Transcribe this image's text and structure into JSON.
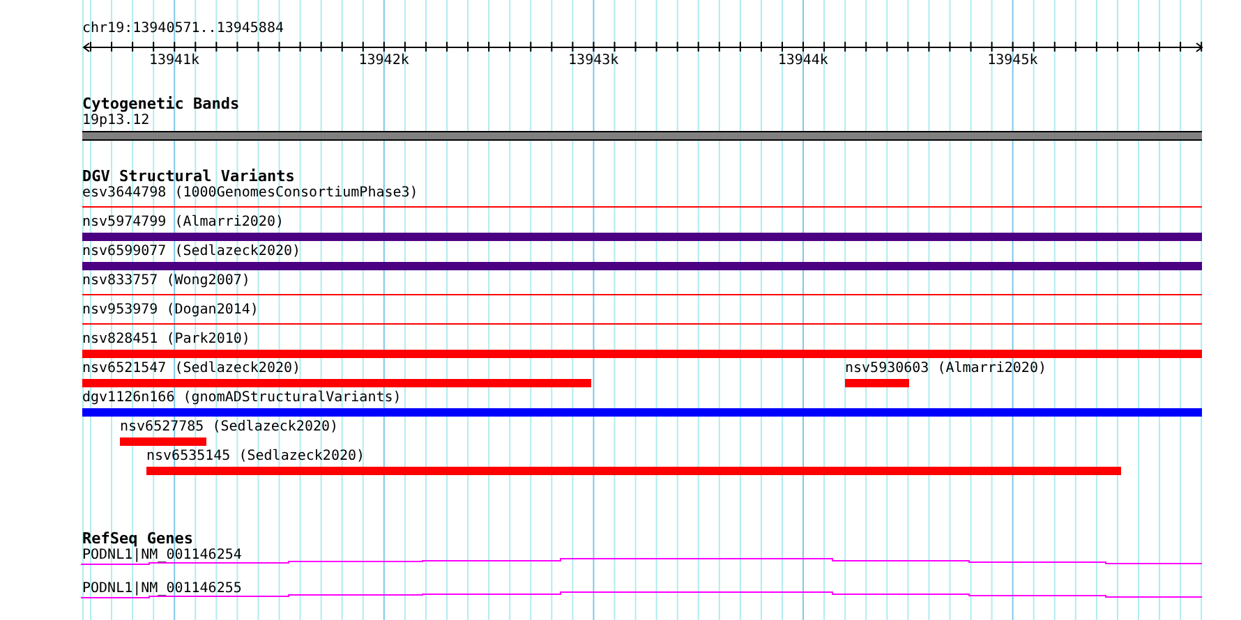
{
  "ruler": {
    "location": "chr19:13940571..13945884",
    "ticks": [
      "13941k",
      "13942k",
      "13943k",
      "13944k",
      "13945k"
    ]
  },
  "cytoband_track": {
    "title": "Cytogenetic Bands",
    "band": "19p13.12"
  },
  "variant_track": {
    "title": "DGV Structural Variants",
    "features": [
      {
        "label": "esv3644798 (1000GenomesConsortiumPhase3)",
        "kind": "line",
        "color": "#ff0000"
      },
      {
        "label": "nsv5974799 (Almarri2020)",
        "kind": "bar",
        "color": "#4b0082"
      },
      {
        "label": "nsv6599077 (Sedlazeck2020)",
        "kind": "bar",
        "color": "#4b0082"
      },
      {
        "label": "nsv833757 (Wong2007)",
        "kind": "line",
        "color": "#ff0000"
      },
      {
        "label": "nsv953979 (Dogan2014)",
        "kind": "line",
        "color": "#ff0000"
      },
      {
        "label": "nsv828451 (Park2010)",
        "kind": "bar",
        "color": "#ff0000"
      },
      {
        "label": "nsv6521547 (Sedlazeck2020)",
        "kind": "bar",
        "color": "#ff0000"
      },
      {
        "label": "nsv5930603 (Almarri2020)",
        "kind": "bar",
        "color": "#ff0000"
      },
      {
        "label": "dgv1126n166 (gnomADStructuralVariants)",
        "kind": "bar",
        "color": "#0000ff"
      },
      {
        "label": "nsv6527785 (Sedlazeck2020)",
        "kind": "bar",
        "color": "#ff0000"
      },
      {
        "label": "nsv6535145 (Sedlazeck2020)",
        "kind": "bar",
        "color": "#ff0000"
      }
    ]
  },
  "gene_track": {
    "title": "RefSeq Genes",
    "genes": [
      {
        "label": "PODNL1|NM_001146254"
      },
      {
        "label": "PODNL1|NM_001146255"
      }
    ]
  }
}
